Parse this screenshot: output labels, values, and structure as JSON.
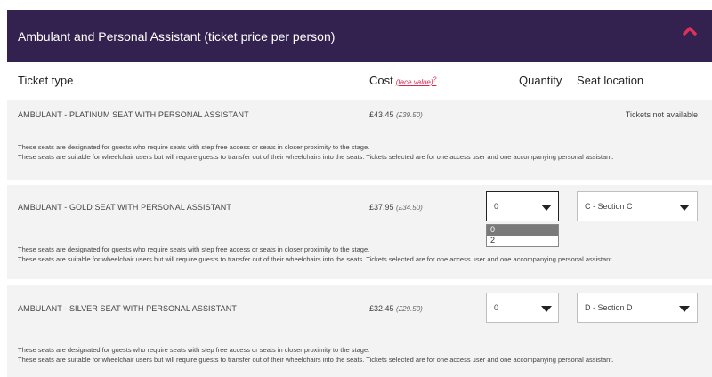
{
  "section": {
    "title": "Ambulant and Personal Assistant (ticket price per person)",
    "accent": "#d5284f",
    "header_bg": "#33214f"
  },
  "columns": {
    "ticket_type": "Ticket type",
    "cost": "Cost",
    "face_value_link": "(face value)",
    "face_value_sup": "?",
    "quantity": "Quantity",
    "seat_location": "Seat location"
  },
  "rows": [
    {
      "name": "AMBULANT - PLATINUM SEAT WITH PERSONAL ASSISTANT",
      "price": "£43.45",
      "face_value": "(£39.50)",
      "status": "Tickets not available",
      "desc1": "These seats are designated for guests who require seats with step free access or seats in closer proximity to the stage.",
      "desc2": "These seats are suitable for wheelchair users but will require guests to transfer out of their wheelchairs into the seats. Tickets selected are for one access user and one accompanying personal assistant."
    },
    {
      "name": "AMBULANT - GOLD SEAT WITH PERSONAL ASSISTANT",
      "price": "£37.95",
      "face_value": "(£34.50)",
      "quantity": "0",
      "quantity_options": [
        "0",
        "2"
      ],
      "seat": "C - Section C",
      "desc1": "These seats are designated for guests who require seats with step free access or seats in closer proximity to the stage.",
      "desc2": "These seats are suitable for wheelchair users but will require guests to transfer out of their wheelchairs into the seats. Tickets selected are for one access user and one accompanying personal assistant."
    },
    {
      "name": "AMBULANT - SILVER SEAT WITH PERSONAL ASSISTANT",
      "price": "£32.45",
      "face_value": "(£29.50)",
      "quantity": "0",
      "seat": "D - Section D",
      "desc1": "These seats are designated for guests who require seats with step free access or seats in closer proximity to the stage.",
      "desc2": "These seats are suitable for wheelchair users but will require guests to transfer out of their wheelchairs into the seats. Tickets selected are for one access user and one accompanying personal assistant."
    }
  ],
  "icons": {
    "collapse": "chevron-up-icon",
    "dropdown": "caret-down-icon"
  }
}
